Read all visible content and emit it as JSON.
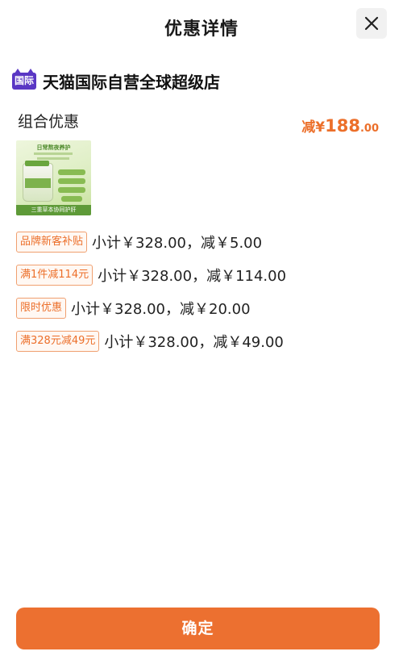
{
  "header": {
    "title": "优惠详情",
    "close_icon": "close-icon"
  },
  "store": {
    "badge_text": "国际",
    "badge_color": "#5a37c4",
    "name": "天猫国际自营全球超级店"
  },
  "combo": {
    "label": "组合优惠",
    "discount_prefix": "减¥",
    "discount_integer": "188",
    "discount_decimal": ".00",
    "accent_color": "#ec6f2a"
  },
  "product_thumb": {
    "headline": "日常熬夜养护",
    "footer": "三重草本协同护肝"
  },
  "promotions": [
    {
      "tag": "品牌新客补贴",
      "text": "小计￥328.00，减￥5.00"
    },
    {
      "tag": "满1件减114元",
      "text": "小计￥328.00，减￥114.00"
    },
    {
      "tag": "限时优惠",
      "text": "小计￥328.00，减￥20.00"
    },
    {
      "tag": "满328元减49元",
      "text": "小计￥328.00，减￥49.00"
    }
  ],
  "footer": {
    "confirm_label": "确定",
    "button_color": "#ec7030"
  }
}
